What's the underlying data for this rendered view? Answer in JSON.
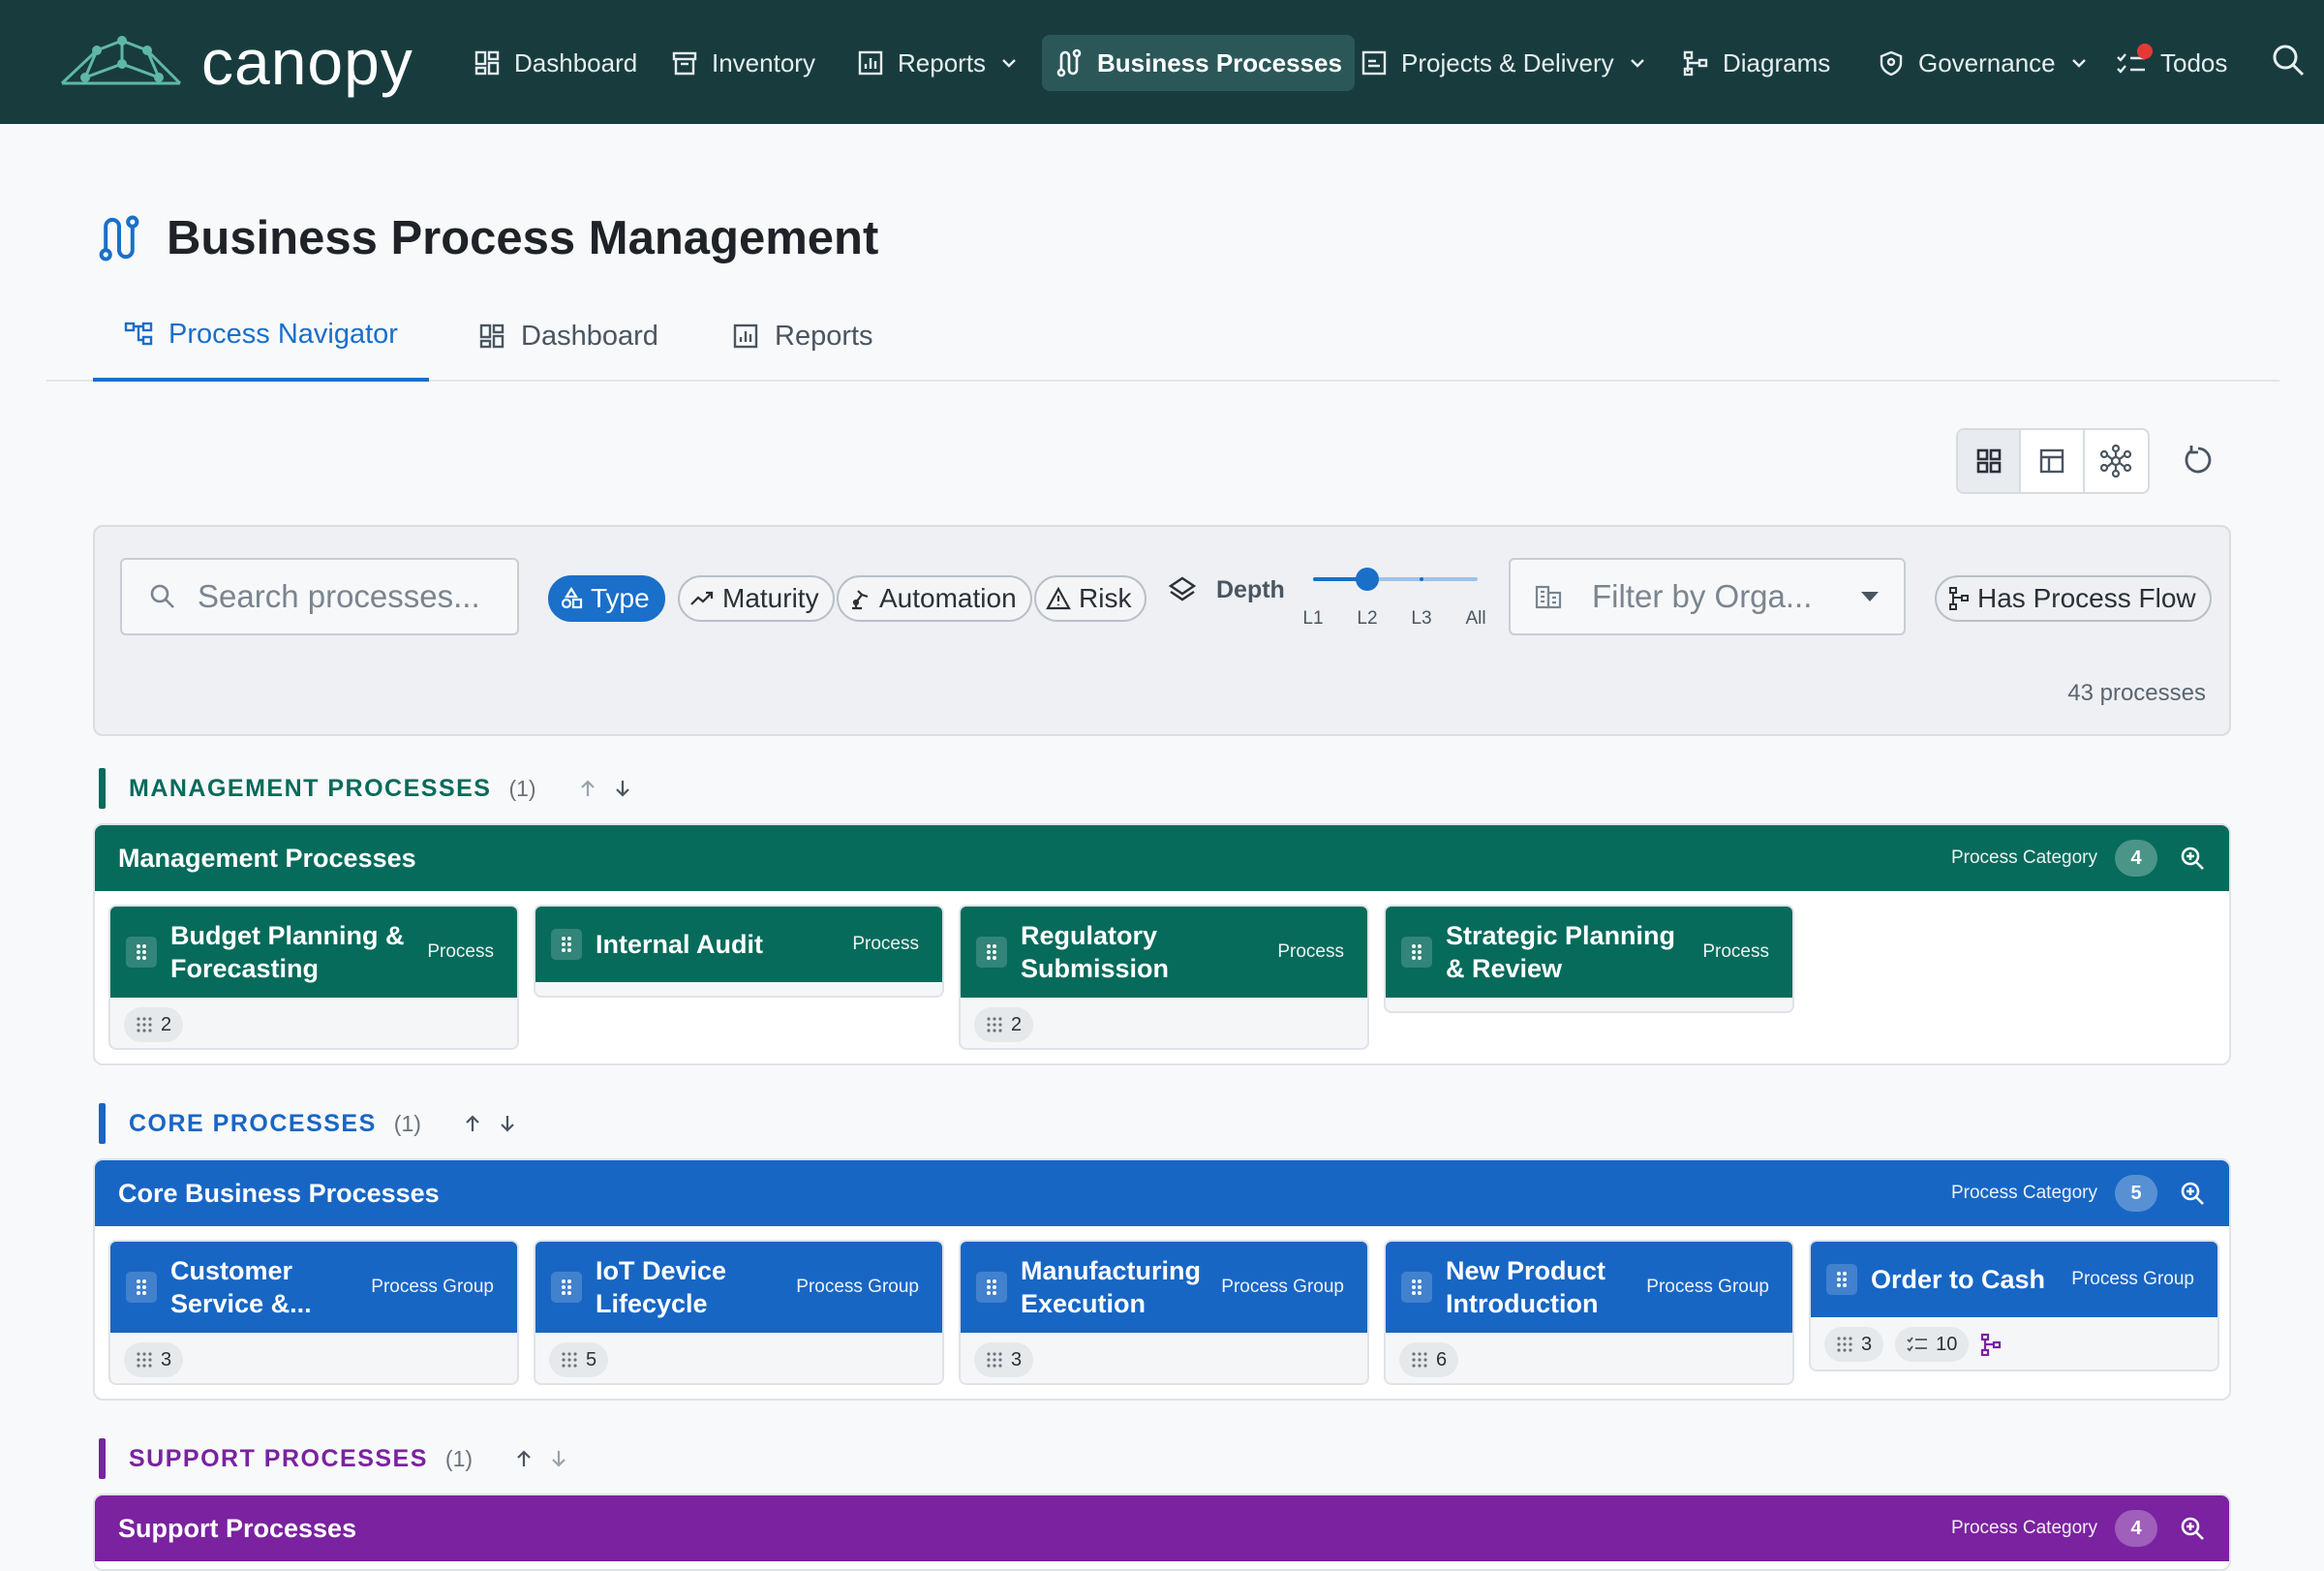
{
  "app": {
    "brand": "canopy"
  },
  "nav": {
    "items": [
      {
        "label": "Dashboard",
        "icon": "dashboard-icon"
      },
      {
        "label": "Inventory",
        "icon": "archive-icon"
      },
      {
        "label": "Reports",
        "icon": "reports-icon",
        "dropdown": true
      },
      {
        "label": "Business Processes",
        "icon": "process-icon",
        "active": true
      },
      {
        "label": "Projects & Delivery",
        "icon": "projects-icon",
        "dropdown": true
      },
      {
        "label": "Diagrams",
        "icon": "diagram-icon"
      },
      {
        "label": "Governance",
        "icon": "shield-icon",
        "dropdown": true
      },
      {
        "label": "Todos",
        "icon": "todo-icon",
        "notification": true
      }
    ]
  },
  "page": {
    "title": "Business Process Management",
    "tabs": [
      {
        "label": "Process Navigator",
        "active": true
      },
      {
        "label": "Dashboard"
      },
      {
        "label": "Reports"
      }
    ]
  },
  "filters": {
    "search_placeholder": "Search processes...",
    "chips": [
      {
        "label": "Type",
        "active": true
      },
      {
        "label": "Maturity"
      },
      {
        "label": "Automation"
      },
      {
        "label": "Risk"
      }
    ],
    "depth_label": "Depth",
    "depth_levels": [
      "L1",
      "L2",
      "L3",
      "All"
    ],
    "depth_selected": "L2",
    "org_placeholder": "Filter by Orga...",
    "has_flow_label": "Has Process Flow",
    "count_text": "43 processes"
  },
  "colors": {
    "nav_bg": "#183c3e",
    "accent": "#1a6fc9",
    "management": "#066b5b",
    "core": "#1866c4",
    "support": "#7a22a0"
  },
  "sections": [
    {
      "title": "MANAGEMENT PROCESSES",
      "count": "(1)",
      "category": {
        "name": "Management Processes",
        "type_label": "Process Category",
        "badge": "4",
        "cards": [
          {
            "name": "Budget Planning & Forecasting",
            "type": "Process",
            "children": "2"
          },
          {
            "name": "Internal Audit",
            "type": "Process"
          },
          {
            "name": "Regulatory Submission",
            "type": "Process",
            "children": "2"
          },
          {
            "name": "Strategic Planning & Review",
            "type": "Process"
          }
        ]
      }
    },
    {
      "title": "CORE PROCESSES",
      "count": "(1)",
      "category": {
        "name": "Core Business Processes",
        "type_label": "Process Category",
        "badge": "5",
        "cards": [
          {
            "name": "Customer Service &...",
            "type": "Process Group",
            "children": "3"
          },
          {
            "name": "IoT Device Lifecycle",
            "type": "Process Group",
            "children": "5"
          },
          {
            "name": "Manufacturing Execution",
            "type": "Process Group",
            "children": "3"
          },
          {
            "name": "New Product Introduction",
            "type": "Process Group",
            "children": "6"
          },
          {
            "name": "Order to Cash",
            "type": "Process Group",
            "children": "3",
            "todos": "10",
            "has_flow": true
          }
        ]
      }
    },
    {
      "title": "SUPPORT PROCESSES",
      "count": "(1)",
      "category": {
        "name": "Support Processes",
        "type_label": "Process Category",
        "badge": "4"
      }
    }
  ]
}
